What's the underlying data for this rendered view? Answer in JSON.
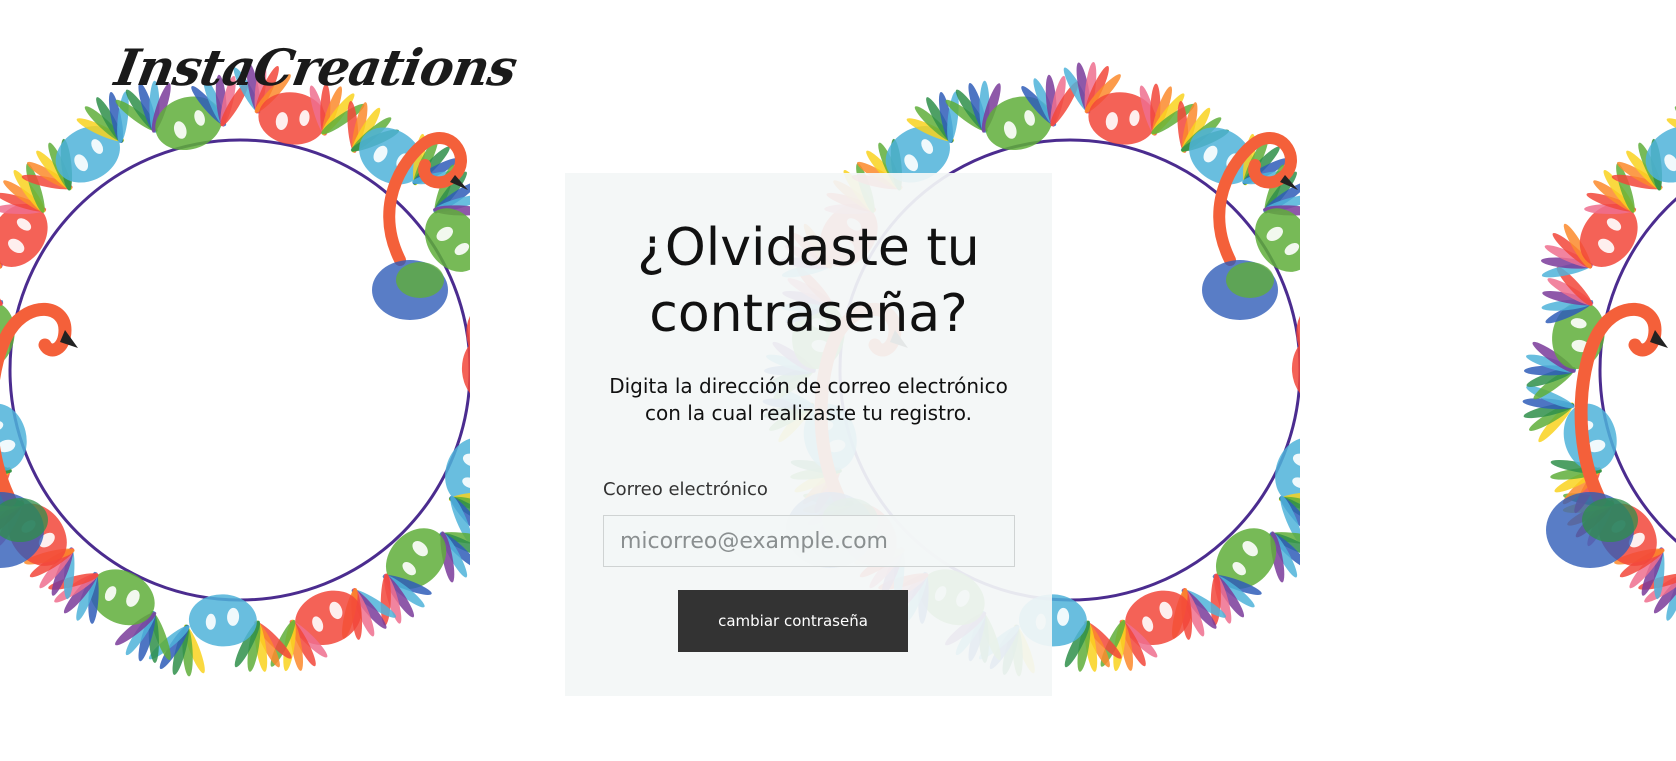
{
  "logo": {
    "text": "InstaCreations"
  },
  "form": {
    "title": "¿Olvidaste tu contraseña?",
    "description": "Digita la dirección de correo electrónico con la cual realizaste tu registro.",
    "email_label": "Correo electrónico",
    "email_placeholder": "micorreo@example.com",
    "email_value": "",
    "submit_label": "cambiar contraseña"
  },
  "decor": {
    "ring_color": "#4b2c8f",
    "leaf_colors": [
      "#f2463a",
      "#fb8a2c",
      "#f9d21f",
      "#5fae3a",
      "#2f8f4a",
      "#2f5db8",
      "#4fb3d9",
      "#7a3b9a",
      "#ef6f8e"
    ],
    "flamingo_color": "#f4603a",
    "icon": "tropical-flamingo-wreath-illustration"
  }
}
